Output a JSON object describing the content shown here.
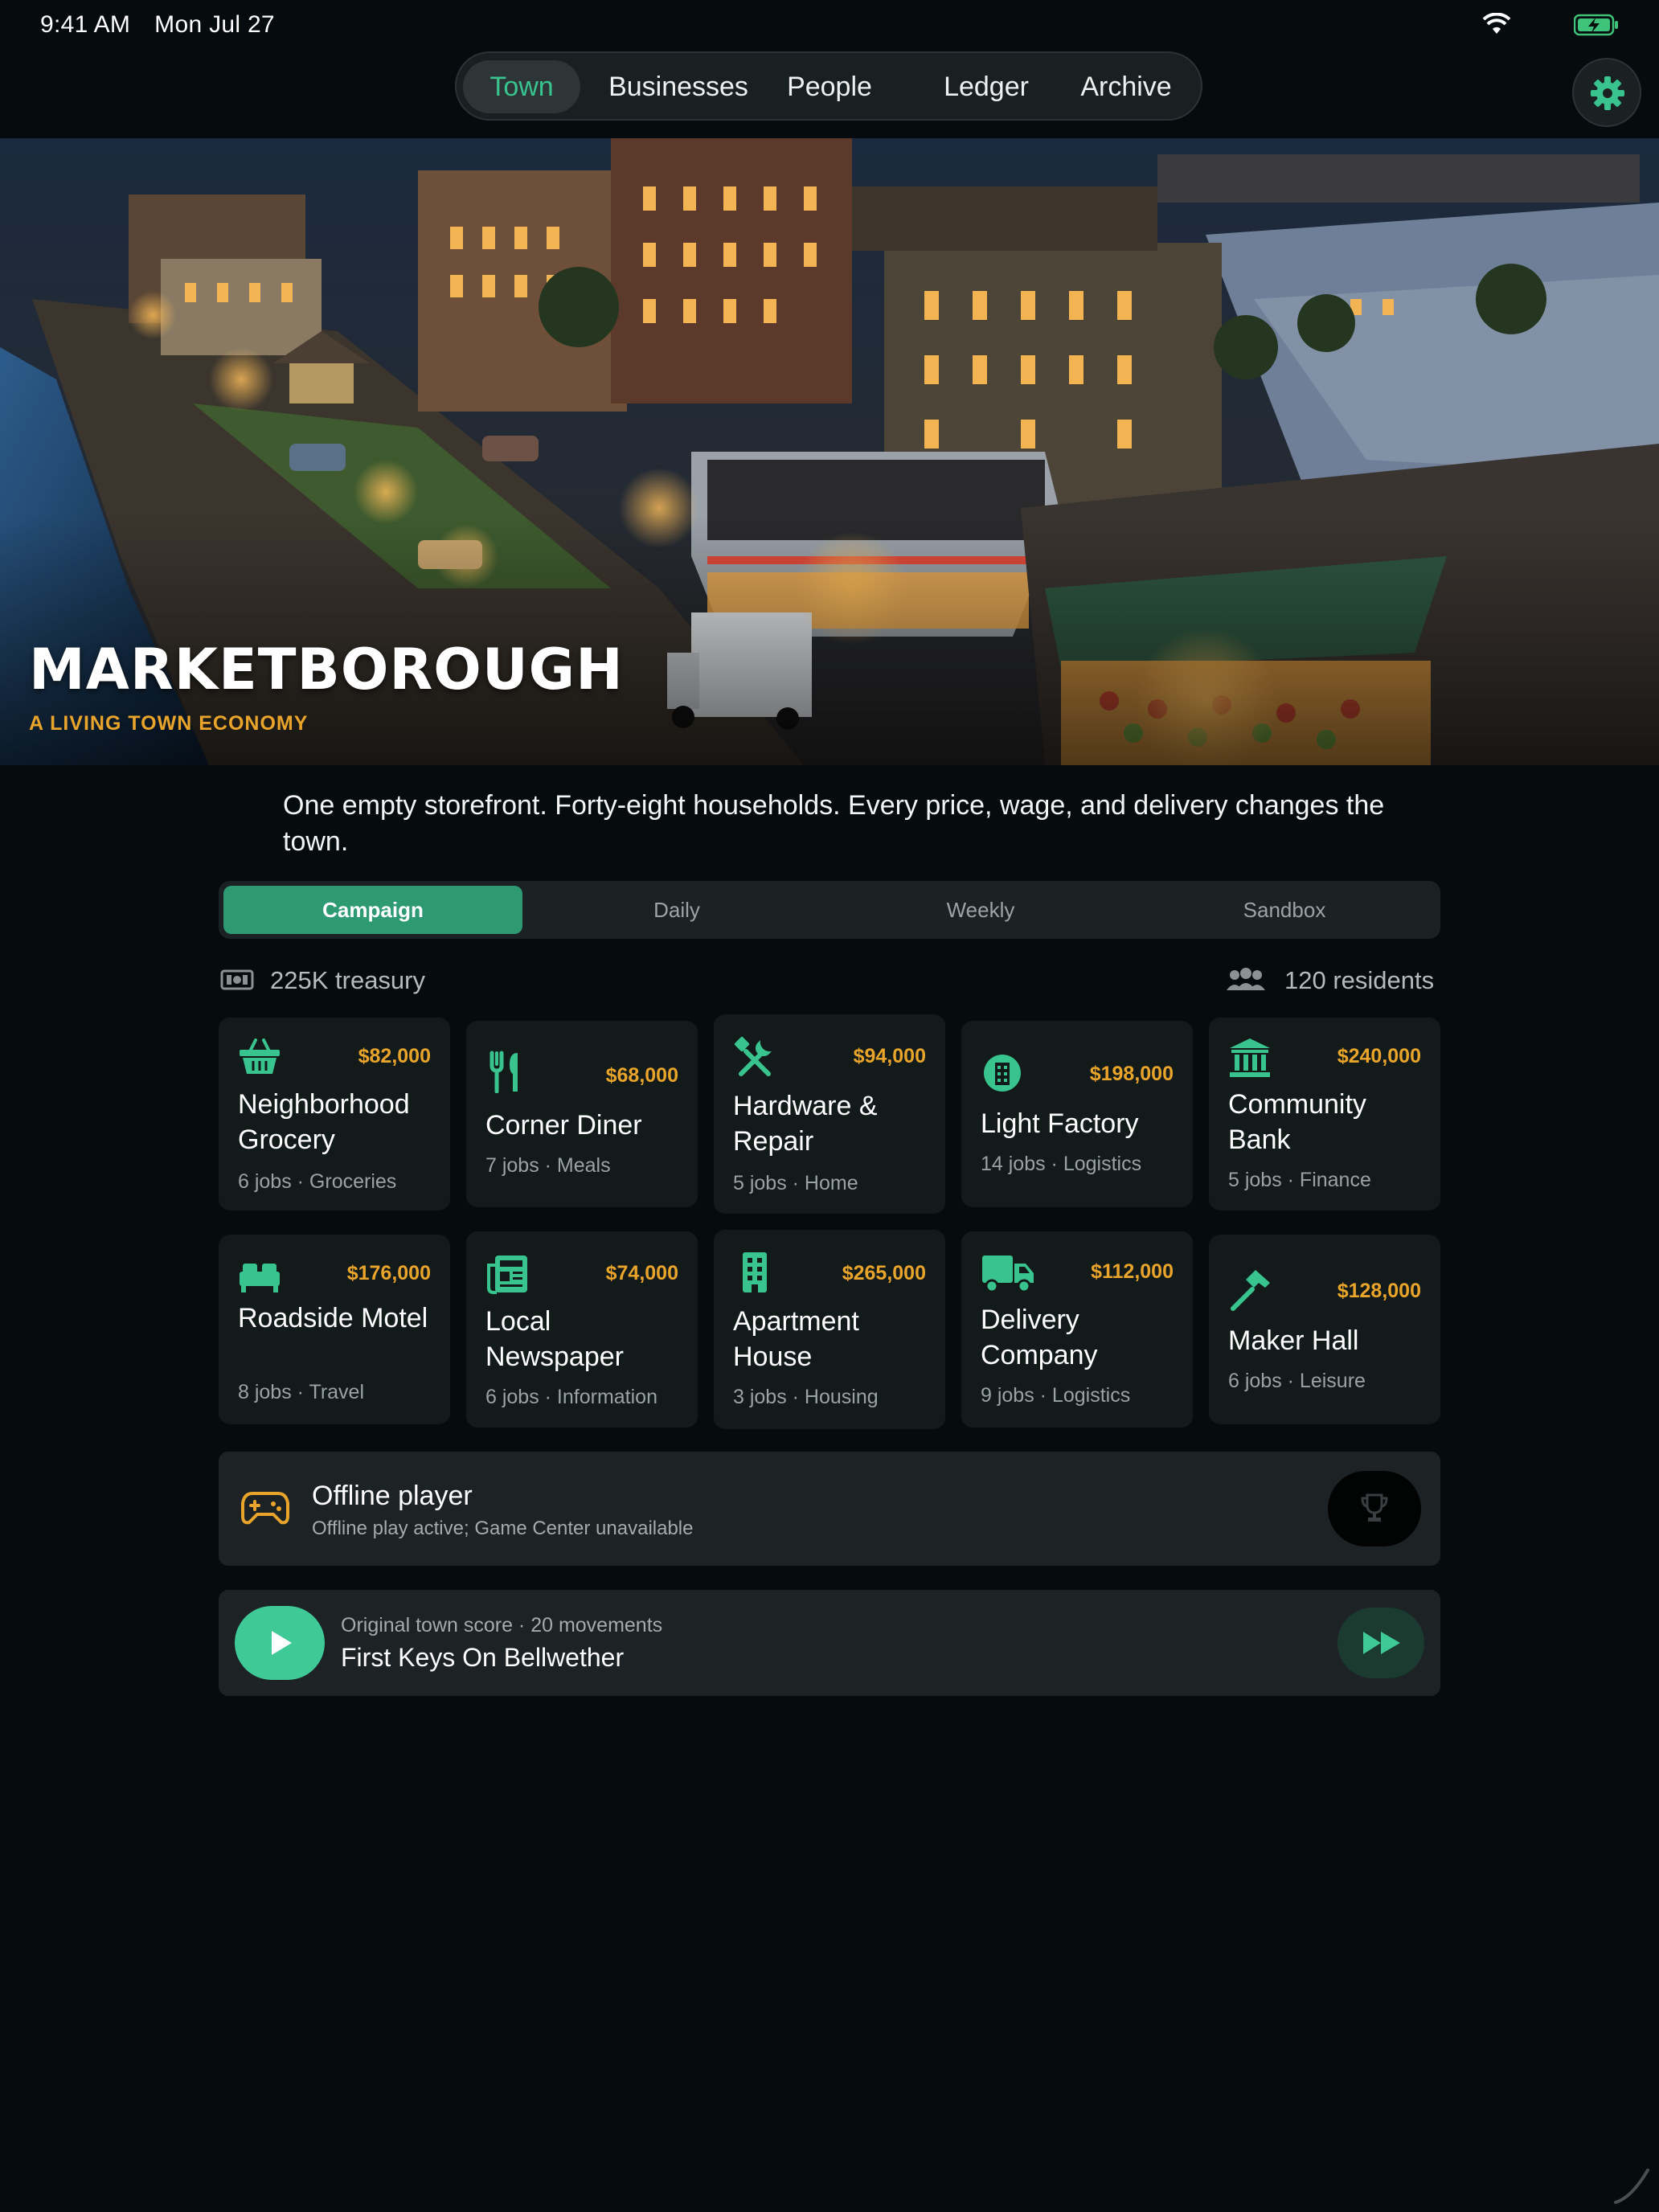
{
  "status_bar": {
    "time": "9:41 AM",
    "date": "Mon Jul 27",
    "wifi_icon": "wifi-icon",
    "battery_icon": "battery-charging-icon"
  },
  "nav": {
    "tabs": [
      {
        "label": "Town",
        "active": true
      },
      {
        "label": "Businesses",
        "active": false
      },
      {
        "label": "People",
        "active": false
      },
      {
        "label": "Ledger",
        "active": false
      },
      {
        "label": "Archive",
        "active": false
      }
    ],
    "settings_icon": "gear-icon"
  },
  "hero": {
    "title": "MARKETBOROUGH",
    "subtitle": "A LIVING TOWN ECONOMY"
  },
  "tagline": "One empty storefront. Forty-eight households. Every price, wage, and delivery changes the town.",
  "modes": [
    {
      "label": "Campaign",
      "active": true
    },
    {
      "label": "Daily",
      "active": false
    },
    {
      "label": "Weekly",
      "active": false
    },
    {
      "label": "Sandbox",
      "active": false
    }
  ],
  "stats": {
    "treasury": "225K treasury",
    "residents": "120 residents"
  },
  "businesses": [
    {
      "name": "Neighborhood Grocery",
      "price": "$82,000",
      "meta": "6 jobs · Groceries",
      "icon": "basket-icon"
    },
    {
      "name": "Corner Diner",
      "price": "$68,000",
      "meta": "7 jobs · Meals",
      "icon": "fork-knife-icon"
    },
    {
      "name": "Hardware & Repair",
      "price": "$94,000",
      "meta": "5 jobs · Home",
      "icon": "tools-icon"
    },
    {
      "name": "Light Factory",
      "price": "$198,000",
      "meta": "14 jobs · Logistics",
      "icon": "factory-icon"
    },
    {
      "name": "Community Bank",
      "price": "$240,000",
      "meta": "5 jobs · Finance",
      "icon": "bank-icon"
    },
    {
      "name": "Roadside Motel",
      "price": "$176,000",
      "meta": "8 jobs · Travel",
      "icon": "bed-icon"
    },
    {
      "name": "Local Newspaper",
      "price": "$74,000",
      "meta": "6 jobs · Information",
      "icon": "newspaper-icon"
    },
    {
      "name": "Apartment House",
      "price": "$265,000",
      "meta": "3 jobs · Housing",
      "icon": "building-icon"
    },
    {
      "name": "Delivery Company",
      "price": "$112,000",
      "meta": "9 jobs · Logistics",
      "icon": "truck-icon"
    },
    {
      "name": "Maker Hall",
      "price": "$128,000",
      "meta": "6 jobs · Leisure",
      "icon": "hammer-icon"
    }
  ],
  "player": {
    "title": "Offline player",
    "status": "Offline play active; Game Center unavailable",
    "icon": "gamepad-icon",
    "trophy_icon": "trophy-icon"
  },
  "music": {
    "subtitle": "Original town score · 20 movements",
    "title": "First Keys On Bellwether",
    "play_icon": "play-icon",
    "skip_icon": "fast-forward-icon"
  },
  "colors": {
    "accent": "#39c48f",
    "gold": "#e9a42b",
    "background": "#060b0d",
    "card": "#131a1a"
  }
}
